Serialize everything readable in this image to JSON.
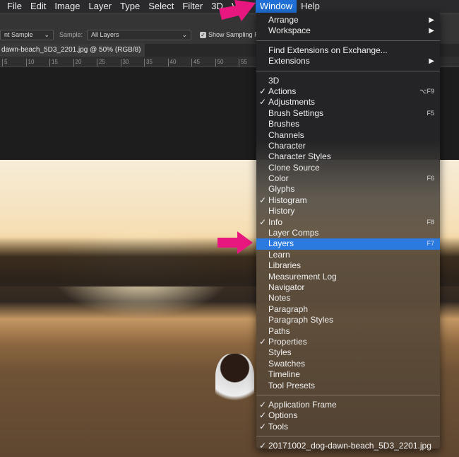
{
  "menubar": [
    "File",
    "Edit",
    "Image",
    "Layer",
    "Type",
    "Select",
    "Filter",
    "3D",
    "View",
    "Window",
    "Help"
  ],
  "options": {
    "sample_size": "nt Sample",
    "sample_label": "Sample:",
    "sample_value": "All Layers",
    "show_ring": "Show Sampling Ri"
  },
  "doc_tab": "dawn-beach_5D3_2201.jpg @ 50% (RGB/8)",
  "ruler": [
    "5",
    "10",
    "15",
    "20",
    "25",
    "30",
    "35",
    "40",
    "45",
    "50",
    "55",
    "5"
  ],
  "menu": {
    "group1": [
      {
        "label": "Arrange",
        "submenu": true
      },
      {
        "label": "Workspace",
        "submenu": true
      }
    ],
    "group2": [
      {
        "label": "Find Extensions on Exchange..."
      },
      {
        "label": "Extensions",
        "submenu": true
      }
    ],
    "group3": [
      {
        "label": "3D"
      },
      {
        "label": "Actions",
        "checked": true,
        "shortcut": "⌥F9"
      },
      {
        "label": "Adjustments",
        "checked": true
      },
      {
        "label": "Brush Settings",
        "shortcut": "F5"
      },
      {
        "label": "Brushes"
      },
      {
        "label": "Channels"
      },
      {
        "label": "Character"
      },
      {
        "label": "Character Styles"
      },
      {
        "label": "Clone Source"
      },
      {
        "label": "Color",
        "shortcut": "F6"
      },
      {
        "label": "Glyphs"
      },
      {
        "label": "Histogram",
        "checked": true
      },
      {
        "label": "History"
      },
      {
        "label": "Info",
        "checked": true,
        "shortcut": "F8"
      },
      {
        "label": "Layer Comps"
      },
      {
        "label": "Layers",
        "shortcut": "F7",
        "highlighted": true
      },
      {
        "label": "Learn"
      },
      {
        "label": "Libraries"
      },
      {
        "label": "Measurement Log"
      },
      {
        "label": "Navigator"
      },
      {
        "label": "Notes"
      },
      {
        "label": "Paragraph"
      },
      {
        "label": "Paragraph Styles"
      },
      {
        "label": "Paths"
      },
      {
        "label": "Properties",
        "checked": true
      },
      {
        "label": "Styles"
      },
      {
        "label": "Swatches"
      },
      {
        "label": "Timeline"
      },
      {
        "label": "Tool Presets"
      }
    ],
    "group4": [
      {
        "label": "Application Frame",
        "checked": true
      },
      {
        "label": "Options",
        "checked": true
      },
      {
        "label": "Tools",
        "checked": true
      }
    ],
    "group5": [
      {
        "label": "20171002_dog-dawn-beach_5D3_2201.jpg",
        "checked": true
      }
    ]
  },
  "colors": {
    "highlight": "#2a7ae0",
    "arrow": "#e8177f"
  }
}
